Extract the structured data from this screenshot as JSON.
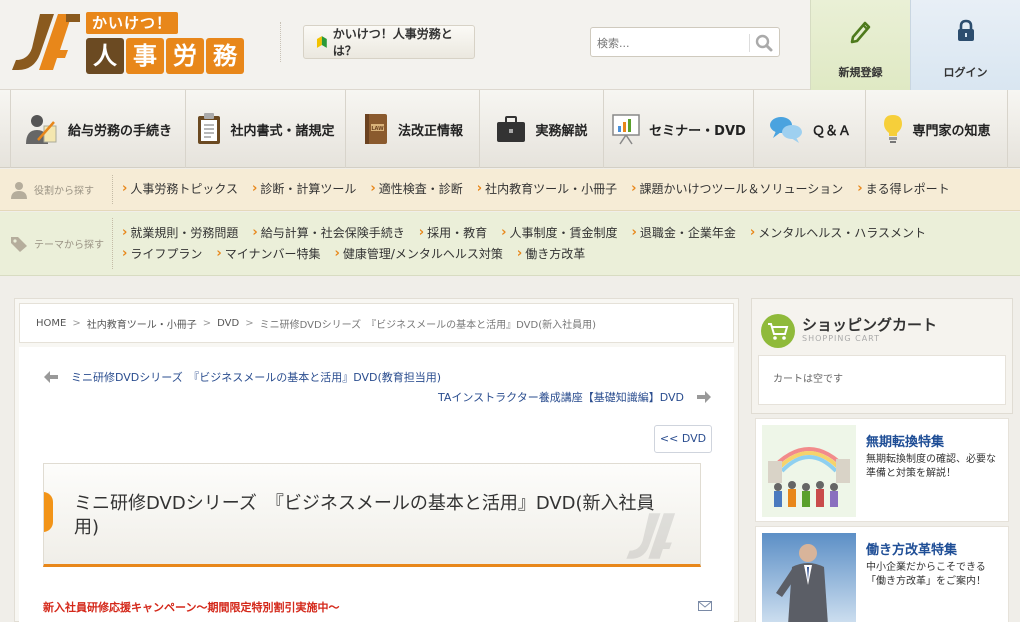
{
  "header": {
    "logo_sub": "かいけつ！",
    "logo_main": [
      "人",
      "事",
      "労",
      "務"
    ],
    "about_label": "かいけつ！人事労務とは？",
    "search_placeholder": "検索...",
    "register_label": "新規登録",
    "login_label": "ログイン"
  },
  "mainnav": {
    "items": [
      {
        "label": "給与労務の手続き",
        "icon": "worker-icon"
      },
      {
        "label": "社内書式・諸規定",
        "icon": "clipboard-icon"
      },
      {
        "label": "法改正情報",
        "icon": "law-book-icon"
      },
      {
        "label": "実務解説",
        "icon": "briefcase-icon"
      },
      {
        "label": "セミナー・DVD",
        "icon": "presentation-board-icon"
      },
      {
        "label": "Ｑ＆Ａ",
        "icon": "speech-bubbles-icon"
      },
      {
        "label": "専門家の知恵",
        "icon": "lightbulb-icon"
      }
    ]
  },
  "role_bar": {
    "label": "役割から探す",
    "links": [
      "人事労務トピックス",
      "診断・計算ツール",
      "適性検査・診断",
      "社内教育ツール・小冊子",
      "課題かいけつツール＆ソリューション",
      "まる得レポート"
    ]
  },
  "theme_bar": {
    "label": "テーマから探す",
    "links": [
      "就業規則・労務問題",
      "給与計算・社会保険手続き",
      "採用・教育",
      "人事制度・賃金制度",
      "退職金・企業年金",
      "メンタルヘルス・ハラスメント",
      "ライフプラン",
      "マイナンバー特集",
      "健康管理/メンタルヘルス対策",
      "働き方改革"
    ]
  },
  "breadcrumb": {
    "items": [
      "HOME",
      "社内教育ツール・小冊子",
      "DVD"
    ],
    "current": "ミニ研修DVDシリーズ　『ビジネスメールの基本と活用』DVD(新入社員用)"
  },
  "content": {
    "prev_label": "ミニ研修DVDシリーズ　『ビジネスメールの基本と活用』DVD(教育担当用)",
    "next_label": "TAインストラクター養成講座【基礎知識編】DVD",
    "back_label": "<< DVD",
    "title": "ミニ研修DVDシリーズ　『ビジネスメールの基本と活用』DVD(新入社員用)",
    "campaign": "新入社員研修応援キャンペーン～期間限定特別割引実施中～"
  },
  "sidebar": {
    "cart_title": "ショッピングカート",
    "cart_sub": "SHOPPING CART",
    "cart_empty": "カートは空です",
    "promos": [
      {
        "title": "無期転換特集",
        "desc": "無期転換制度の確認、必要な準備と対策を解説！"
      },
      {
        "title": "働き方改革特集",
        "desc": "中小企業だからこそできる「働き方改革」をご案内！"
      }
    ]
  },
  "colors": {
    "accent": "#e8871a",
    "link_blue": "#1f4e96",
    "campaign_red": "#d4281a"
  }
}
